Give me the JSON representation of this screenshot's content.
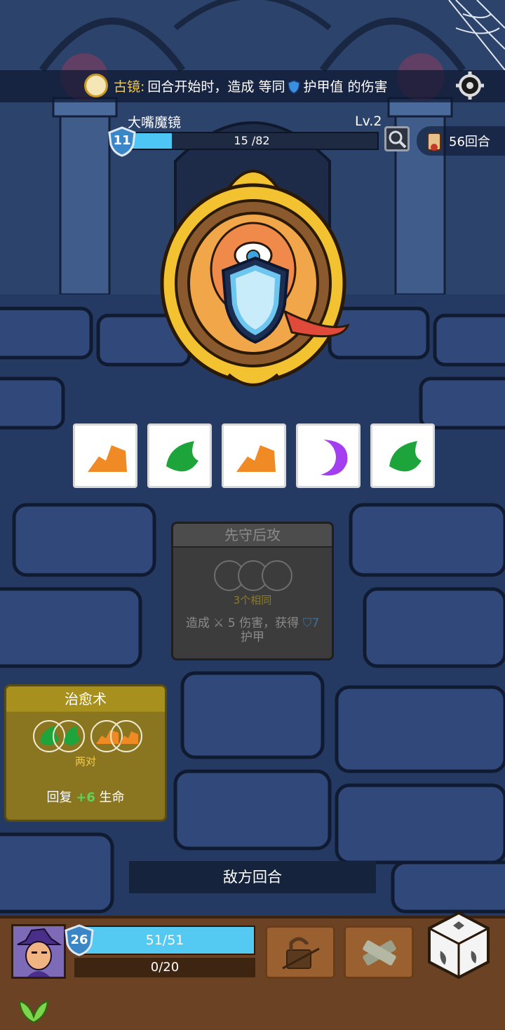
{
  "relic": {
    "name": "古镜:",
    "effect_part1": "回合开始时，造成 等同",
    "effect_part2": "护甲值 的伤害",
    "icon": "mirror-relic-icon"
  },
  "enemy": {
    "name": "大嘴魔镜",
    "level": "Lv.2",
    "armor": "11",
    "hp_text": "15 /82",
    "hp_current": 15,
    "hp_max": 82
  },
  "rounds": {
    "label": "56回合",
    "icon": "scroll-icon"
  },
  "intent_dice": [
    {
      "icon": "orange-rock-icon",
      "color": "#f08a24"
    },
    {
      "icon": "green-leaf-icon",
      "color": "#1da53b"
    },
    {
      "icon": "orange-rock-icon",
      "color": "#f08a24"
    },
    {
      "icon": "purple-moon-icon",
      "color": "#a33ff0"
    },
    {
      "icon": "green-leaf-icon",
      "color": "#1da53b"
    }
  ],
  "enemy_skill": {
    "title": "先守后攻",
    "requirement": "3个相同",
    "desc_prefix": "造成",
    "desc_damage": "5 伤害，获得",
    "desc_armor": "7",
    "desc_suffix": "护甲"
  },
  "heal_skill": {
    "title": "治愈术",
    "requirement": "两对",
    "desc_prefix": "回复",
    "desc_amount": "+6",
    "desc_suffix": "生命"
  },
  "turn_banner": "敌方回合",
  "player": {
    "armor": "26",
    "hp_text": "51/51",
    "xp_text": "0/20"
  },
  "colors": {
    "hp_bar": "#4ec6f5",
    "gold_text": "#f2c94c",
    "heal_green": "#5fd35b"
  }
}
